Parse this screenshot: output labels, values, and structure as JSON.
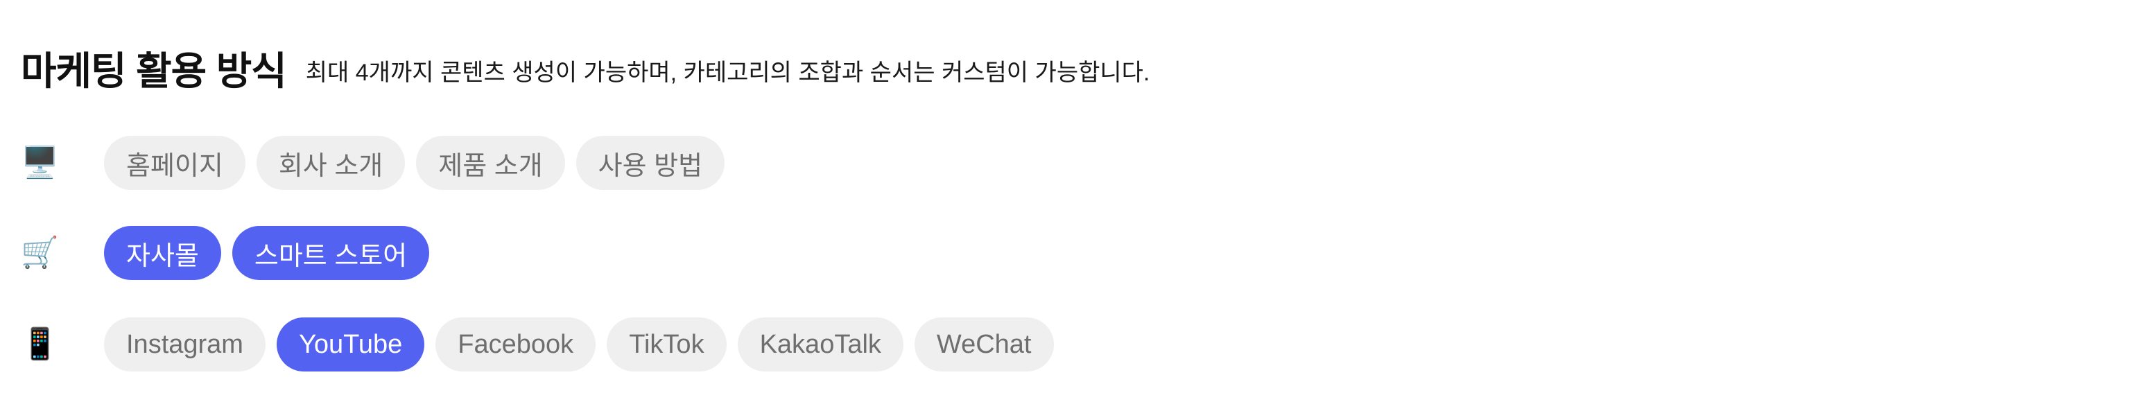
{
  "header": {
    "title": "마케팅 활용 방식",
    "subtitle": "최대 4개까지 콘텐츠 생성이 가능하며, 카테고리의 조합과 순서는 커스텀이 가능합니다."
  },
  "colors": {
    "selected_bg": "#5462f2",
    "selected_text": "#ffffff",
    "chip_bg": "#efefef",
    "chip_text": "#6e6e6e"
  },
  "rows": [
    {
      "icon_name": "desktop-computer-icon",
      "icon_glyph": "🖥️",
      "chips": [
        {
          "label": "홈페이지",
          "selected": false
        },
        {
          "label": "회사 소개",
          "selected": false
        },
        {
          "label": "제품 소개",
          "selected": false
        },
        {
          "label": "사용 방법",
          "selected": false
        }
      ]
    },
    {
      "icon_name": "shopping-cart-icon",
      "icon_glyph": "🛒",
      "chips": [
        {
          "label": "자사몰",
          "selected": true
        },
        {
          "label": "스마트 스토어",
          "selected": true
        }
      ]
    },
    {
      "icon_name": "mobile-phone-icon",
      "icon_glyph": "📱",
      "chips": [
        {
          "label": "Instagram",
          "selected": false
        },
        {
          "label": "YouTube",
          "selected": true
        },
        {
          "label": "Facebook",
          "selected": false
        },
        {
          "label": "TikTok",
          "selected": false
        },
        {
          "label": "KakaoTalk",
          "selected": false
        },
        {
          "label": "WeChat",
          "selected": false
        }
      ]
    }
  ]
}
